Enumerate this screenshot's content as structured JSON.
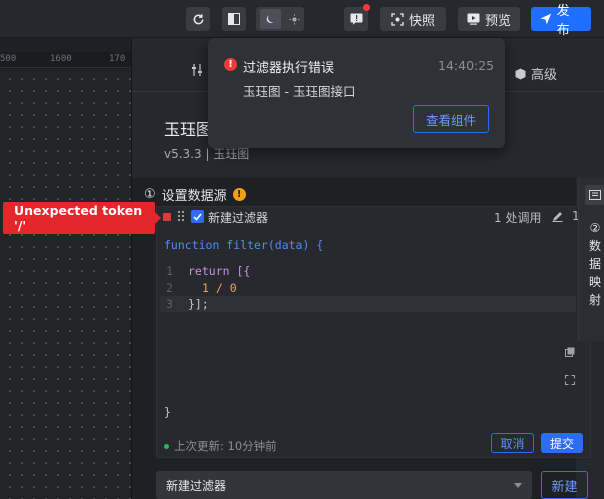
{
  "topbar": {
    "snapshot_label": "快照",
    "preview_label": "预览",
    "publish_label": "发布"
  },
  "ruler": {
    "ticks": [
      "500",
      "1600",
      "170"
    ]
  },
  "panel": {
    "tabs": {
      "advanced_label": "高级"
    },
    "component_title": "玉珏图",
    "component_version": "v5.3.3 | 玉珏图"
  },
  "datasource": {
    "title": "设置数据源",
    "step_number": "①",
    "filter": {
      "name": "新建过滤器",
      "usage": "1 处调用",
      "code_header": "function filter(data) {",
      "code_lines": [
        {
          "no": "1",
          "text": "return [{"
        },
        {
          "no": "2",
          "text": "1 / 0"
        },
        {
          "no": "3",
          "text": "}];"
        }
      ],
      "code_footer": "}",
      "last_update": "上次更新: 10分钟前",
      "cancel_label": "取消",
      "submit_label": "提交"
    },
    "select_value": "新建过滤器",
    "new_button_label": "新建"
  },
  "side_tab": {
    "step": "②",
    "label_chars": [
      "数",
      "据",
      "映",
      "射"
    ]
  },
  "error_toast": {
    "message": "Unexpected token '/'"
  },
  "notification": {
    "title": "过滤器执行错误",
    "time": "14:40:25",
    "body": "玉珏图 - 玉珏图接口",
    "action_label": "查看组件"
  },
  "colors": {
    "accent": "#2d6df5",
    "error": "#e5262b",
    "warning": "#f4a014"
  }
}
